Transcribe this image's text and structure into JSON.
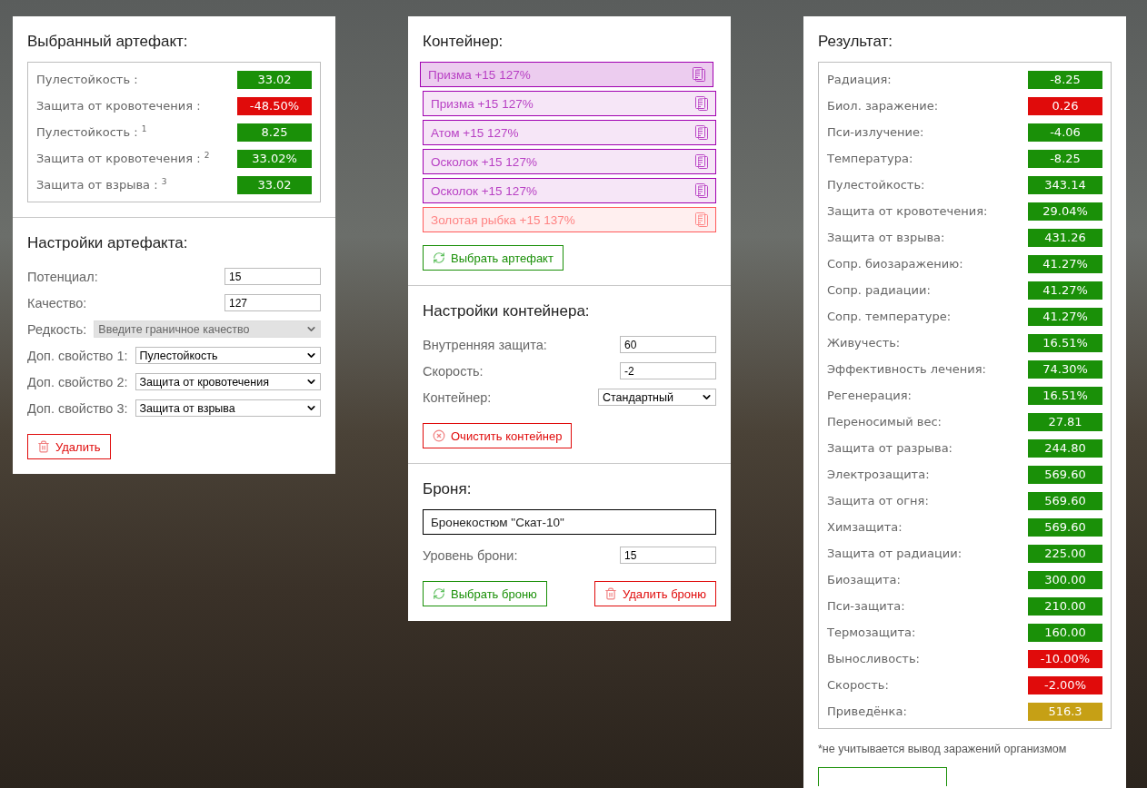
{
  "selected_artifact": {
    "title": "Выбранный артефакт:",
    "stats": [
      {
        "label": "Пулестойкость :",
        "value": "33.02",
        "color": "#1a9008"
      },
      {
        "label": "Защита от кровотечения :",
        "value": "-48.50%",
        "color": "#e00b0b"
      },
      {
        "label": "Пулестойкость : $^{1}$",
        "value": "8.25",
        "color": "#1a9008"
      },
      {
        "label": "Защита от кровотечения : $^{2}$",
        "value": "33.02%",
        "color": "#1a9008"
      },
      {
        "label": "Защита от взрыва : $^{3}$",
        "value": "33.02",
        "color": "#1a9008"
      }
    ]
  },
  "artifact_settings": {
    "title": "Настройки артефакта:",
    "fields": [
      {
        "kind": "input",
        "label": "Потенциал:",
        "value": "15"
      },
      {
        "kind": "input",
        "label": "Качество:",
        "value": "127"
      },
      {
        "kind": "select",
        "label": "Редкость:",
        "value": "Введите граничное качество",
        "disabled": true
      },
      {
        "kind": "select",
        "label": "Доп. свойство 1:",
        "value": "Пулестойкость",
        "disabled": false
      },
      {
        "kind": "select",
        "label": "Доп. свойство 2:",
        "value": "Защита от кровотечения",
        "disabled": false
      },
      {
        "kind": "select",
        "label": "Доп. свойство 3:",
        "value": "Защита от взрыва",
        "disabled": false
      }
    ],
    "delete_button": "Удалить"
  },
  "container": {
    "title": "Контейнер:",
    "items": [
      {
        "label": "Призма +15 127%",
        "selected": true,
        "color": "#a000b0"
      },
      {
        "label": "Призма +15 127%",
        "selected": false,
        "color": "#a000b0"
      },
      {
        "label": "Атом +15 127%",
        "selected": false,
        "color": "#a000b0"
      },
      {
        "label": "Осколок +15 127%",
        "selected": false,
        "color": "#a000b0"
      },
      {
        "label": "Осколок +15 127%",
        "selected": false,
        "color": "#a000b0"
      },
      {
        "label": "Золотая рыбка +15 137%",
        "selected": false,
        "color": "#ff5a5a"
      }
    ],
    "pick_button": "Выбрать артефакт"
  },
  "container_settings": {
    "title": "Настройки контейнера:",
    "fields": [
      {
        "kind": "input",
        "label": "Внутренняя защита:",
        "value": "60"
      },
      {
        "kind": "input",
        "label": "Скорость:",
        "value": "-2"
      },
      {
        "kind": "select",
        "label": "Контейнер:",
        "value": "Стандартный",
        "disabled": false
      }
    ],
    "clear_button": "Очистить контейнер"
  },
  "armor": {
    "title": "Броня:",
    "name": "Бронекостюм \"Скат-10\"",
    "fields": [
      {
        "kind": "input",
        "label": "Уровень брони:",
        "value": "15"
      }
    ],
    "pick_button": "Выбрать броню",
    "delete_button": "Удалить броню"
  },
  "result": {
    "title": "Результат:",
    "stats": [
      {
        "label": "Радиация:",
        "value": "-8.25",
        "color": "#1a9008"
      },
      {
        "label": "Биол. заражение:",
        "value": "0.26",
        "color": "#e00b0b"
      },
      {
        "label": "Пси-излучение:",
        "value": "-4.06",
        "color": "#1a9008"
      },
      {
        "label": "Температура:",
        "value": "-8.25",
        "color": "#1a9008"
      },
      {
        "label": "Пулестойкость:",
        "value": "343.14",
        "color": "#1a9008"
      },
      {
        "label": "Защита от кровотечения:",
        "value": "29.04%",
        "color": "#1a9008"
      },
      {
        "label": "Защита от взрыва:",
        "value": "431.26",
        "color": "#1a9008"
      },
      {
        "label": "Сопр. биозаражению:",
        "value": "41.27%",
        "color": "#1a9008"
      },
      {
        "label": "Сопр. радиации:",
        "value": "41.27%",
        "color": "#1a9008"
      },
      {
        "label": "Сопр. температуре:",
        "value": "41.27%",
        "color": "#1a9008"
      },
      {
        "label": "Живучесть:",
        "value": "16.51%",
        "color": "#1a9008"
      },
      {
        "label": "Эффективность лечения:",
        "value": "74.30%",
        "color": "#1a9008"
      },
      {
        "label": "Регенерация:",
        "value": "16.51%",
        "color": "#1a9008"
      },
      {
        "label": "Переносимый вес:",
        "value": "27.81",
        "color": "#1a9008"
      },
      {
        "label": "Защита от разрыва:",
        "value": "244.80",
        "color": "#1a9008"
      },
      {
        "label": "Электрозащита:",
        "value": "569.60",
        "color": "#1a9008"
      },
      {
        "label": "Защита от огня:",
        "value": "569.60",
        "color": "#1a9008"
      },
      {
        "label": "Химзащита:",
        "value": "569.60",
        "color": "#1a9008"
      },
      {
        "label": "Защита от радиации:",
        "value": "225.00",
        "color": "#1a9008"
      },
      {
        "label": "Биозащита:",
        "value": "300.00",
        "color": "#1a9008"
      },
      {
        "label": "Пси-защита:",
        "value": "210.00",
        "color": "#1a9008"
      },
      {
        "label": "Термозащита:",
        "value": "160.00",
        "color": "#1a9008"
      },
      {
        "label": "Выносливость:",
        "value": "-10.00%",
        "color": "#e00b0b"
      },
      {
        "label": "Скорость:",
        "value": "-2.00%",
        "color": "#e00b0b"
      },
      {
        "label": "Приведёнка:",
        "value": "516.3",
        "color": "#c6a015"
      }
    ],
    "footnote": "*не учитывается вывод заражений организмом"
  }
}
